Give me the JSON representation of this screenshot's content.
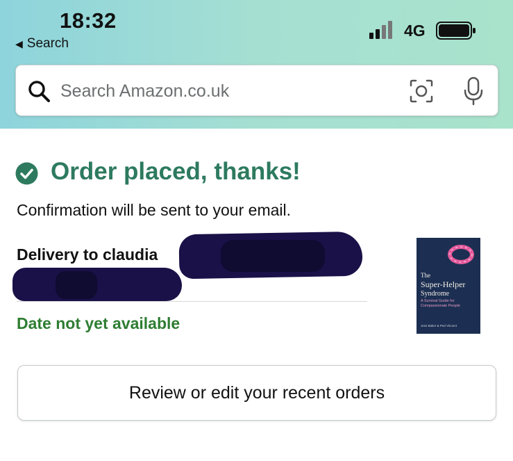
{
  "status_bar": {
    "time": "18:32",
    "back_label": "Search",
    "network": "4G"
  },
  "search": {
    "placeholder": "Search Amazon.co.uk"
  },
  "order": {
    "title": "Order placed, thanks!",
    "confirmation": "Confirmation will be sent to your email.",
    "delivery_label": "Delivery to claudia",
    "date_status": "Date not yet available"
  },
  "book": {
    "title_line1": "The",
    "title_line2": "Super-Helper",
    "title_line3": "Syndrome",
    "subtitle": "A Survival Guide for Compassionate People",
    "authors": "Jess Baker & Ped Vincent"
  },
  "actions": {
    "review_label": "Review or edit your recent orders"
  },
  "colors": {
    "success_green": "#2d7a5f",
    "date_green": "#2e7d32",
    "header_teal": "#8ed4dc",
    "redaction": "#1a1148"
  },
  "icons": [
    "search-icon",
    "camera-icon",
    "mic-icon",
    "check-circle-icon",
    "signal-icon",
    "battery-icon",
    "back-arrow-icon"
  ]
}
